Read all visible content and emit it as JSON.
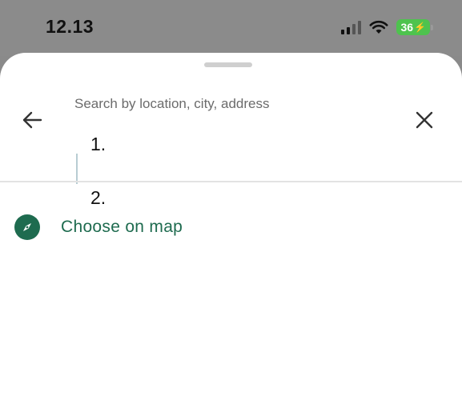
{
  "status_bar": {
    "time": "12.13",
    "battery": "36",
    "battery_color": "#4ec34e"
  },
  "search": {
    "label": "Search by location, city, address",
    "value": ""
  },
  "annotations": {
    "one": "1.",
    "two": "2."
  },
  "choose_on_map": {
    "label": "Choose on map",
    "icon": "compass-icon",
    "color": "#1e6b4f"
  },
  "icons": {
    "back": "arrow-left-icon",
    "close": "close-icon"
  }
}
